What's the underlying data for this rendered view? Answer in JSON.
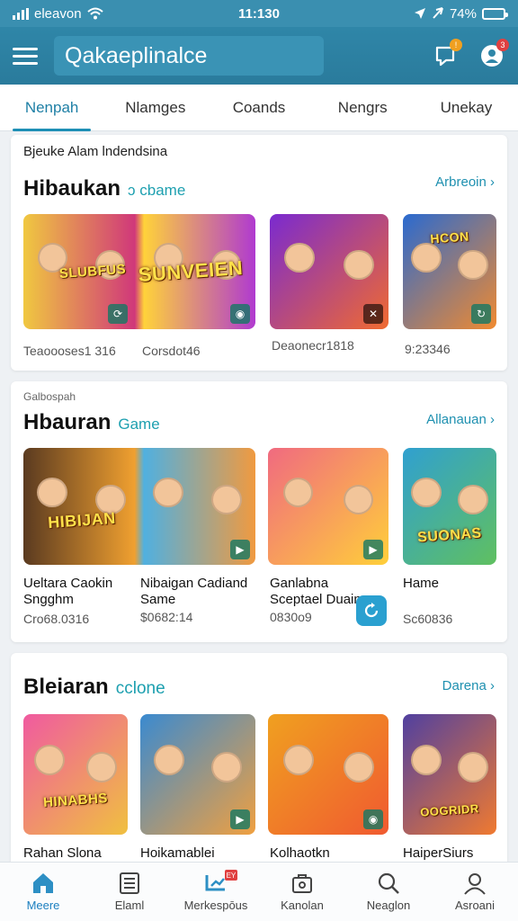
{
  "status_bar": {
    "carrier": "eleavon",
    "time": "11:130",
    "battery": "74%"
  },
  "app_bar": {
    "title": "Qakaeplinalce",
    "notif_badge": "!",
    "profile_badge": "3"
  },
  "tabs": [
    {
      "label": "Nenpah",
      "active": true
    },
    {
      "label": "Nlamges",
      "active": false
    },
    {
      "label": "Coands",
      "active": false
    },
    {
      "label": "Nengrs",
      "active": false
    },
    {
      "label": "Unekay",
      "active": false
    }
  ],
  "sections": [
    {
      "subtitle": "Bjeuke Alam lndendsina",
      "title": "Hibaukan",
      "title_accent": "ɔ cbame",
      "see_all": "Arbreoin ›",
      "tiles": [
        {
          "label": "SLUBFUS",
          "colors": [
            "#f0c840",
            "#d0387a"
          ]
        },
        {
          "label": "SUNVEIEN",
          "colors": [
            "#ffd23a",
            "#b03ad0"
          ]
        },
        {
          "label": "",
          "colors": [
            "#7a2ad0",
            "#f06a30"
          ]
        },
        {
          "label": "HCON",
          "colors": [
            "#2a6ad0",
            "#f08a30"
          ]
        }
      ],
      "metas": [
        "Teaoooses1 316",
        "Corsdot46",
        "Deaonecr1818",
        "9:23346"
      ]
    },
    {
      "subtitle": "Galbospah",
      "title": "Hbauran",
      "title_accent": "Game",
      "see_all": "Allanauan ›",
      "tiles": [
        {
          "label": "HIBIJAN",
          "colors": [
            "#5a3a20",
            "#f0a030"
          ]
        },
        {
          "label": "",
          "colors": [
            "#50b0e0",
            "#f09a40"
          ]
        },
        {
          "label": "",
          "colors": [
            "#f06a80",
            "#ffcf3a"
          ]
        },
        {
          "label": "SUONAS",
          "colors": [
            "#30a0d0",
            "#60c060"
          ]
        }
      ],
      "games": [
        {
          "name": "Ueltara Caokin Sngghm",
          "meta": "Cro68.0316"
        },
        {
          "name": "Nibaigan Cadiand Same",
          "meta": "$0682:14"
        },
        {
          "name": "Ganlabna Sceptael Duaing",
          "meta": "0830o9"
        },
        {
          "name": "Hame",
          "meta": "Sc60836"
        }
      ]
    },
    {
      "subtitle": "",
      "title": "Bleiaran",
      "title_accent": "cclone",
      "see_all": "Darena ›",
      "tiles": [
        {
          "label": "HINABHS",
          "colors": [
            "#f05aa0",
            "#f0c040"
          ]
        },
        {
          "label": "",
          "colors": [
            "#3a8ad0",
            "#f0a040"
          ]
        },
        {
          "label": "",
          "colors": [
            "#f0a020",
            "#f05a30"
          ]
        },
        {
          "label": "OOGRIDR",
          "colors": [
            "#5040a0",
            "#f07a30"
          ]
        }
      ],
      "games": [
        {
          "name": "Rahan Slona"
        },
        {
          "name": "Hoikamablei"
        },
        {
          "name": "Kolhaotkn"
        },
        {
          "name": "HaiperSiurs"
        }
      ]
    }
  ],
  "bottom_nav": [
    {
      "label": "Meere",
      "icon": "home-icon",
      "active": true
    },
    {
      "label": "Elaml",
      "icon": "list-icon",
      "active": false
    },
    {
      "label": "Merkespōus",
      "icon": "market-icon",
      "active": false,
      "badge": "EY"
    },
    {
      "label": "Kanolan",
      "icon": "bag-icon",
      "active": false
    },
    {
      "label": "Neaglon",
      "icon": "search-icon",
      "active": false
    },
    {
      "label": "Asroani",
      "icon": "person-icon",
      "active": false
    }
  ],
  "colors": {
    "primary": "#2f86a8",
    "accent": "#1e90b0",
    "background": "#eef1f4"
  }
}
